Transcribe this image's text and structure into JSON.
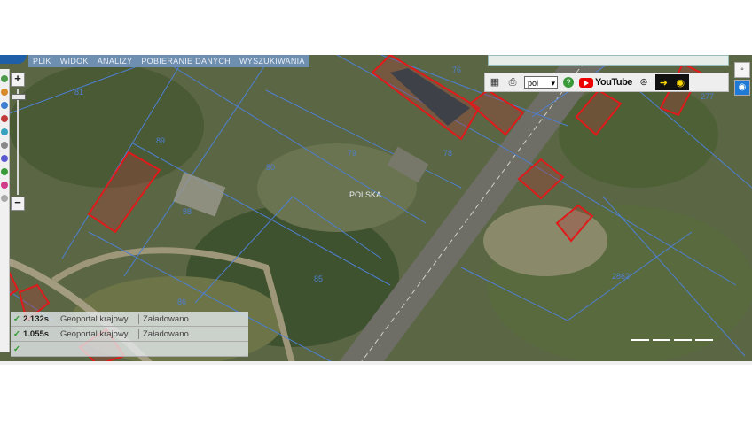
{
  "menu": [
    "PLIK",
    "WIDOK",
    "ANALIZY",
    "POBIERANIE DANYCH",
    "WYSZUKIWANIA"
  ],
  "toolbar": {
    "lang_value": "pol",
    "help_label": "?",
    "youtube_label": "YouTube"
  },
  "map": {
    "place_label": "POLSKA",
    "parcel_numbers": [
      "81",
      "89",
      "80",
      "79",
      "78",
      "76",
      "86",
      "85",
      "88",
      "2862",
      "277"
    ]
  },
  "load_panel": [
    {
      "time": "2.132s",
      "service": "Geoportal krajowy",
      "status": "Załadowano"
    },
    {
      "time": "1.055s",
      "service": "Geoportal krajowy",
      "status": "Załadowano"
    }
  ],
  "colors": {
    "parcel_line": "#4d7fd1",
    "building_outline": "#e01a1a",
    "menubar": "#6f8fb0"
  }
}
